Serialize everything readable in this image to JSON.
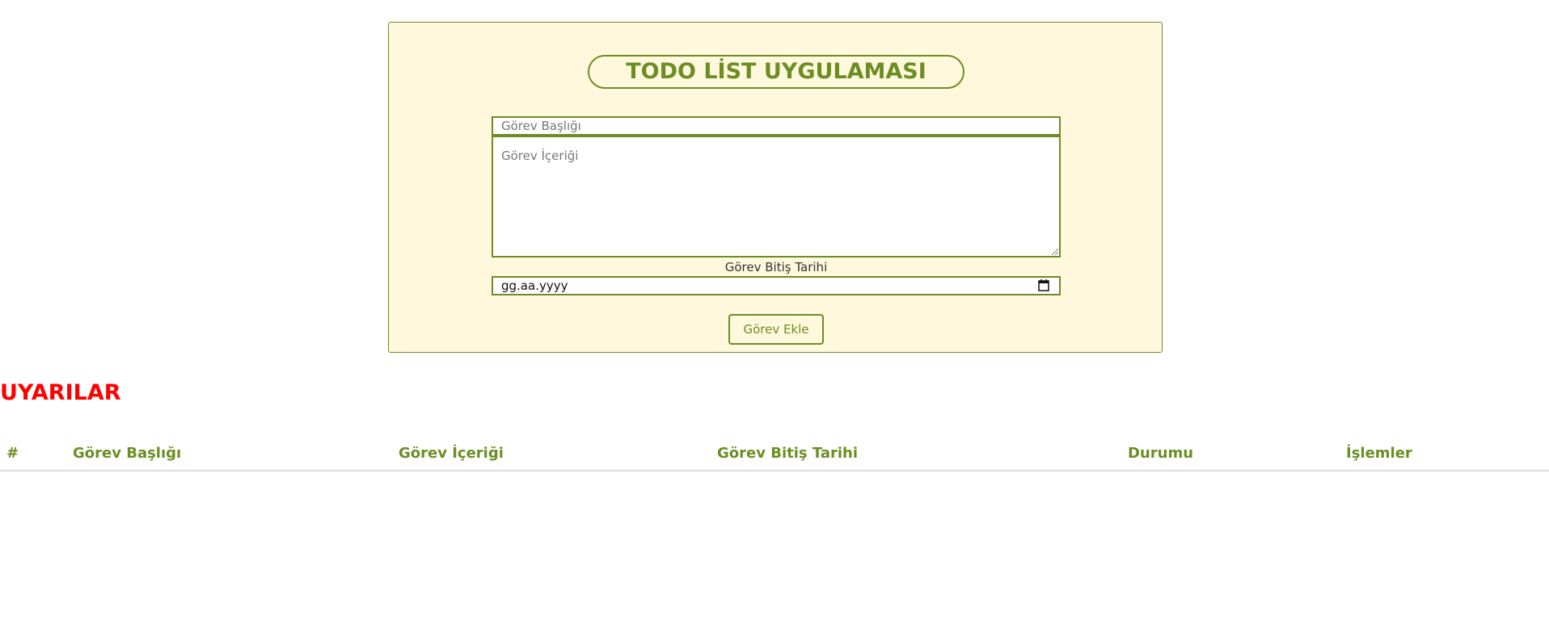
{
  "app": {
    "title": "TODO LİST UYGULAMASI"
  },
  "form": {
    "title_placeholder": "Görev Başlığı",
    "content_placeholder": "Görev İçeriği",
    "date_label": "Görev Bitiş Tarihi",
    "date_value": "gg.aa.yyyy",
    "submit_label": "Görev Ekle"
  },
  "alerts": {
    "heading": "UYARILAR"
  },
  "table": {
    "headers": [
      "#",
      "Görev Başlığı",
      "Görev İçeriği",
      "Görev Bitiş Tarihi",
      "Durumu",
      "İşlemler"
    ]
  },
  "colors": {
    "accent": "#6b8e23",
    "card_bg": "#fff8dc",
    "alert": "#ff0000"
  },
  "icons": {
    "date_picker": "calendar-icon",
    "textarea_resize": "resize-grip-icon"
  }
}
